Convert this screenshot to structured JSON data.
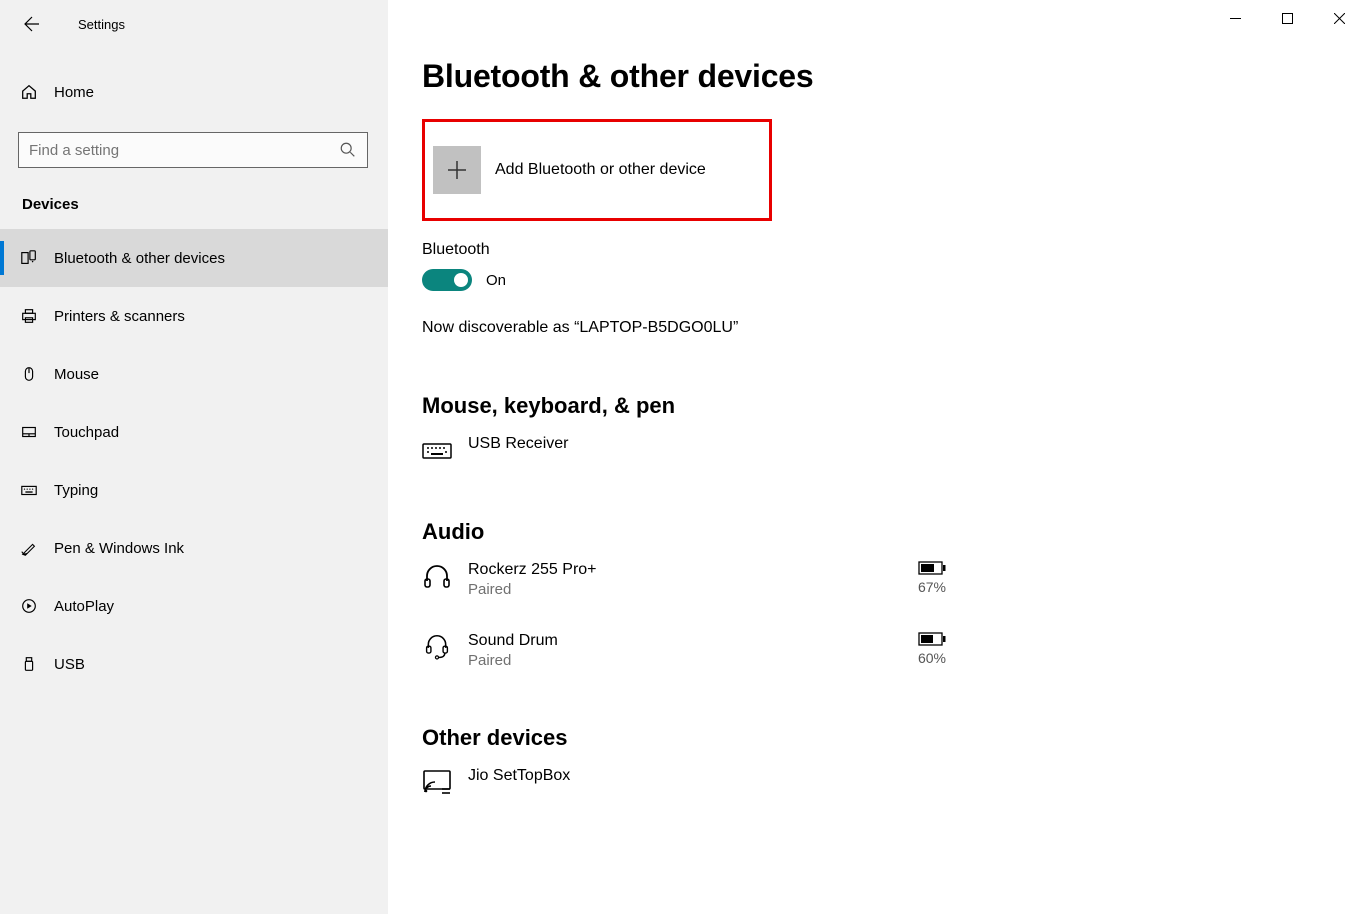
{
  "titlebar": {
    "title": "Settings"
  },
  "home": {
    "label": "Home"
  },
  "search": {
    "placeholder": "Find a setting"
  },
  "section": {
    "title": "Devices"
  },
  "nav": [
    {
      "label": "Bluetooth & other devices"
    },
    {
      "label": "Printers & scanners"
    },
    {
      "label": "Mouse"
    },
    {
      "label": "Touchpad"
    },
    {
      "label": "Typing"
    },
    {
      "label": "Pen & Windows Ink"
    },
    {
      "label": "AutoPlay"
    },
    {
      "label": "USB"
    }
  ],
  "page": {
    "title": "Bluetooth & other devices"
  },
  "add": {
    "label": "Add Bluetooth or other device"
  },
  "bluetooth": {
    "label": "Bluetooth",
    "state": "On",
    "discoverable": "Now discoverable as “LAPTOP-B5DGO0LU”"
  },
  "sections": {
    "mkp": {
      "title": "Mouse, keyboard, & pen",
      "items": [
        {
          "name": "USB Receiver"
        }
      ]
    },
    "audio": {
      "title": "Audio",
      "items": [
        {
          "name": "Rockerz 255 Pro+",
          "status": "Paired",
          "battery": "67%"
        },
        {
          "name": "Sound Drum",
          "status": "Paired",
          "battery": "60%"
        }
      ]
    },
    "other": {
      "title": "Other devices",
      "items": [
        {
          "name": "Jio SetTopBox"
        }
      ]
    }
  }
}
